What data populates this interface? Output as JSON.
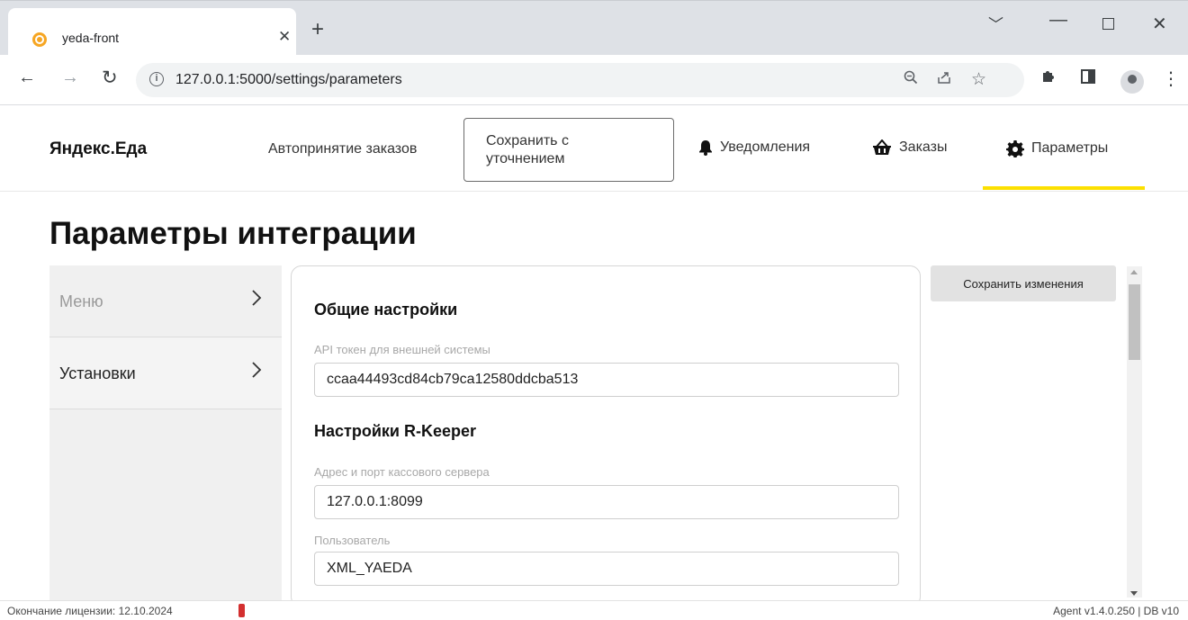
{
  "browser": {
    "tab_title": "yeda-front",
    "url": "127.0.0.1:5000/settings/parameters"
  },
  "header": {
    "brand": "Яндекс.Еда",
    "auto_accept": "Автопринятие заказов",
    "save_clarify_line1": "Сохранить с",
    "save_clarify_line2": "уточнением",
    "notifications": "Уведомления",
    "orders": "Заказы",
    "parameters": "Параметры",
    "active_color": "#fce000"
  },
  "page": {
    "title": "Параметры интеграции"
  },
  "sidebar": {
    "items": [
      {
        "label": "Меню"
      },
      {
        "label": "Установки"
      }
    ]
  },
  "form": {
    "general_title": "Общие настройки",
    "api_token_label": "API токен для внешней системы",
    "api_token_value": "ccaa44493cd84cb79ca12580ddcba513",
    "rkeeper_title": "Настройки R-Keeper",
    "server_label": "Адрес и порт кассового сервера",
    "server_value": "127.0.0.1:8099",
    "user_label": "Пользователь",
    "user_value": "XML_YAEDA"
  },
  "actions": {
    "save_changes": "Сохранить изменения"
  },
  "footer": {
    "license": "Окончание лицензии: 12.10.2024",
    "version": "Agent v1.4.0.250  |  DB v10",
    "license_color": "#d32f2f"
  }
}
